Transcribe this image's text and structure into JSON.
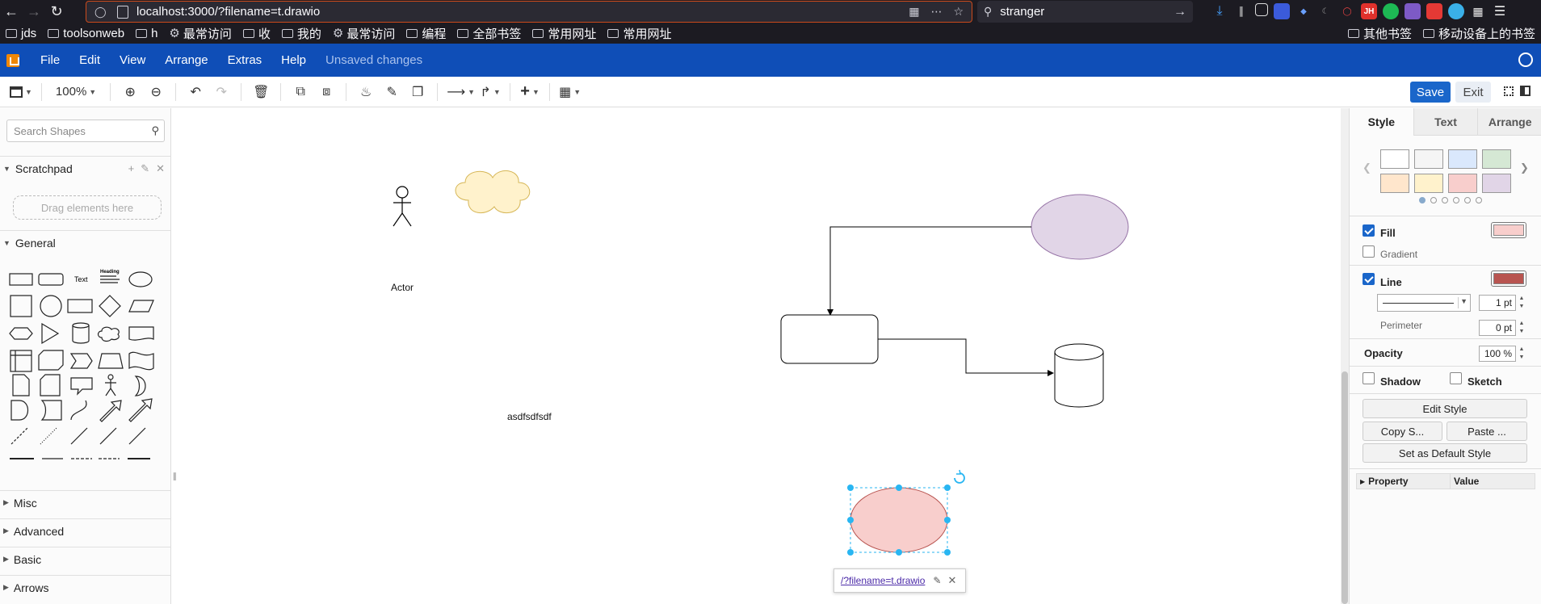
{
  "browser": {
    "url": "localhost:3000/?filename=t.drawio",
    "search_query": "stranger",
    "bookmarks_left": [
      "jds",
      "toolsonweb",
      "h",
      "最常访问",
      "收",
      "我的",
      "最常访问",
      "编程",
      "全部书签",
      "常用网址",
      "常用网址"
    ],
    "bookmarks_right": [
      "其他书签",
      "移动设备上的书签"
    ],
    "extension_badge": "JH"
  },
  "menubar": {
    "items": [
      "File",
      "Edit",
      "View",
      "Arrange",
      "Extras",
      "Help"
    ],
    "status": "Unsaved changes"
  },
  "toolbar": {
    "zoom": "100%",
    "save_label": "Save",
    "exit_label": "Exit"
  },
  "left_panel": {
    "search_placeholder": "Search Shapes",
    "scratchpad_title": "Scratchpad",
    "drag_hint": "Drag elements here",
    "general_title": "General",
    "shape_text_label": "Text",
    "shape_heading_label": "Heading",
    "sections": [
      "Misc",
      "Advanced",
      "Basic",
      "Arrows"
    ]
  },
  "canvas": {
    "actor_label": "Actor",
    "free_text": "asdfsdfsdf",
    "link_text": "/?filename=t.drawio"
  },
  "right_panel": {
    "tabs": [
      "Style",
      "Text",
      "Arrange"
    ],
    "swatch_colors": [
      "#ffffff",
      "#f5f5f5",
      "#dae8fc",
      "#d5e8d4",
      "#ffe6cc",
      "#fff2cc",
      "#f8cecc",
      "#e1d5e7"
    ],
    "swatch_pages": 6,
    "fill_label": "Fill",
    "fill_color": "#f8cecc",
    "gradient_label": "Gradient",
    "line_label": "Line",
    "line_color": "#b85450",
    "line_width": "1 pt",
    "perimeter_label": "Perimeter",
    "perimeter_value": "0 pt",
    "opacity_label": "Opacity",
    "opacity_value": "100 %",
    "shadow_label": "Shadow",
    "sketch_label": "Sketch",
    "edit_style": "Edit Style",
    "copy_style": "Copy S...",
    "paste_style": "Paste ...",
    "set_default": "Set as Default Style",
    "property_header": "Property",
    "value_header": "Value"
  },
  "colors": {
    "menubar": "#0f4eb7",
    "accent": "#1a66ca",
    "selection": "#29b6f2",
    "cloud_fill": "#fff2cc",
    "cloud_stroke": "#d6b656",
    "purple_fill": "#e1d5e7",
    "purple_stroke": "#9673a6",
    "red_fill": "#f8cecc",
    "red_stroke": "#b85450"
  }
}
